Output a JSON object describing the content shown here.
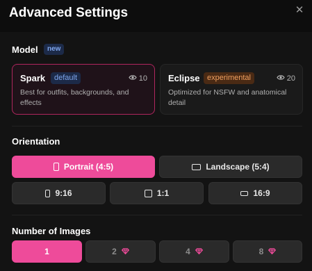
{
  "dialog": {
    "title": "Advanced Settings",
    "close_glyph": "✕"
  },
  "model": {
    "label": "Model",
    "badge": "new",
    "cards": [
      {
        "name": "Spark",
        "tag": "default",
        "cost": "10",
        "description": "Best for outfits, backgrounds, and effects",
        "selected": true
      },
      {
        "name": "Eclipse",
        "tag": "experimental",
        "cost": "20",
        "description": "Optimized for NSFW and anatomical detail",
        "selected": false
      }
    ]
  },
  "orientation": {
    "label": "Orientation",
    "options": [
      {
        "label": "Portrait (4:5)",
        "icon": "portrait-icon",
        "selected": true
      },
      {
        "label": "Landscape (5:4)",
        "icon": "landscape-icon",
        "selected": false
      },
      {
        "label": "9:16",
        "icon": "tall-rect-icon",
        "selected": false
      },
      {
        "label": "1:1",
        "icon": "square-icon",
        "selected": false
      },
      {
        "label": "16:9",
        "icon": "wide-rect-icon",
        "selected": false
      }
    ]
  },
  "images": {
    "label": "Number of Images",
    "options": [
      {
        "label": "1",
        "premium": false,
        "selected": true
      },
      {
        "label": "2",
        "premium": true,
        "selected": false
      },
      {
        "label": "4",
        "premium": true,
        "selected": false
      },
      {
        "label": "8",
        "premium": true,
        "selected": false
      }
    ]
  },
  "colors": {
    "accent": "#ee4b9a",
    "gem": "#ee4b9a",
    "card_active_border": "#b0265e"
  }
}
